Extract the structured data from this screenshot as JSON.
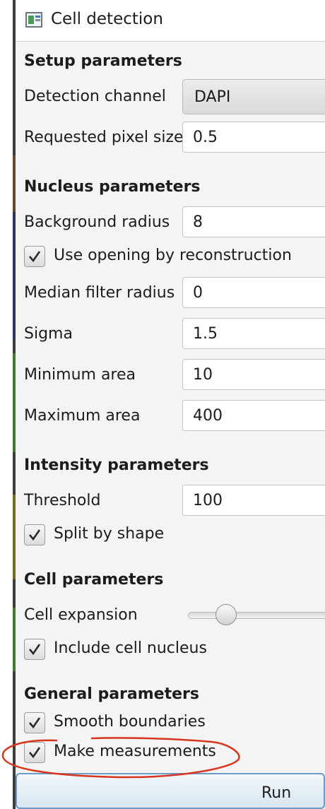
{
  "window": {
    "title": "Cell detection"
  },
  "colors": {
    "annotation": "#d9341e",
    "run_button_border": "#6a9bc9"
  },
  "setup": {
    "heading": "Setup parameters",
    "detection_channel": {
      "label": "Detection channel",
      "value": "DAPI"
    },
    "pixel_size": {
      "label": "Requested pixel size",
      "value": "0.5"
    }
  },
  "nucleus": {
    "heading": "Nucleus parameters",
    "background_radius": {
      "label": "Background radius",
      "value": "8"
    },
    "opening_reconstruction": {
      "label": "Use opening by reconstruction",
      "checked": true
    },
    "median_filter": {
      "label": "Median filter radius",
      "value": "0"
    },
    "sigma": {
      "label": "Sigma",
      "value": "1.5"
    },
    "min_area": {
      "label": "Minimum area",
      "value": "10"
    },
    "max_area": {
      "label": "Maximum area",
      "value": "400"
    }
  },
  "intensity": {
    "heading": "Intensity parameters",
    "threshold": {
      "label": "Threshold",
      "value": "100"
    },
    "split_by_shape": {
      "label": "Split by shape",
      "checked": true
    }
  },
  "cell": {
    "heading": "Cell parameters",
    "expansion": {
      "label": "Cell expansion",
      "slider_fraction": 0.28
    },
    "include_nucleus": {
      "label": "Include cell nucleus",
      "checked": true
    }
  },
  "general": {
    "heading": "General parameters",
    "smooth_boundaries": {
      "label": "Smooth boundaries",
      "checked": true
    },
    "make_measurements": {
      "label": "Make measurements",
      "checked": true
    }
  },
  "actions": {
    "run_label": "Run"
  }
}
